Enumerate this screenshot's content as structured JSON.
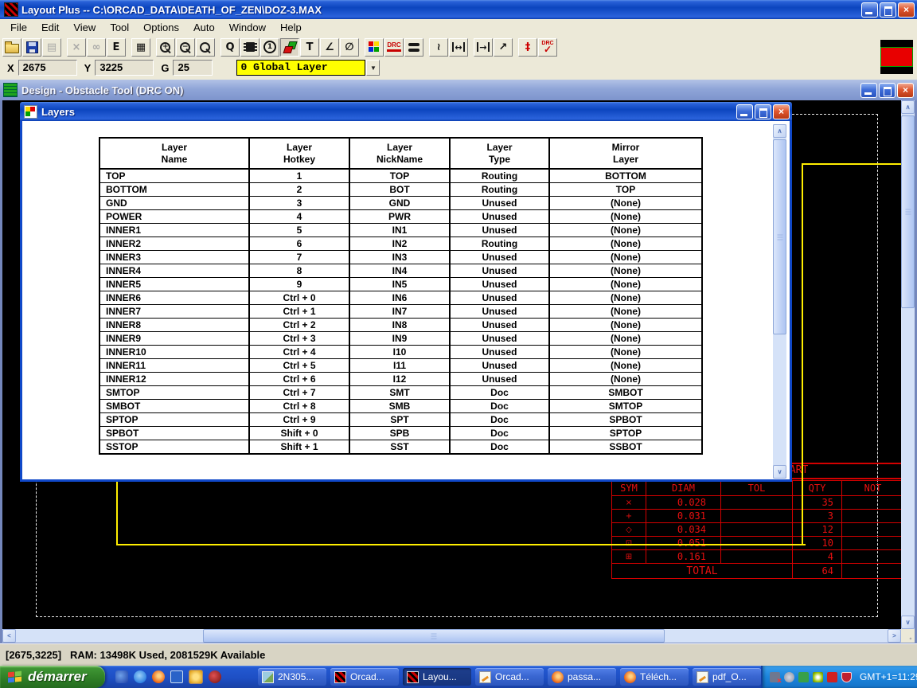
{
  "window": {
    "title": "Layout Plus -- C:\\ORCAD_DATA\\DEATH_OF_ZEN\\DOZ-3.MAX"
  },
  "menu": {
    "items": [
      "File",
      "Edit",
      "View",
      "Tool",
      "Options",
      "Auto",
      "Window",
      "Help"
    ]
  },
  "toolbar": {
    "buttons": [
      {
        "name": "open-button",
        "icon": "open-folder-icon",
        "kind": "folder"
      },
      {
        "name": "save-button",
        "icon": "save-floppy-icon",
        "kind": "floppy"
      },
      {
        "name": "library-button",
        "icon": "library-icon",
        "kind": "glyph",
        "glyph": "▤",
        "disabled": true
      },
      {
        "name": "delete-button",
        "icon": "delete-icon",
        "kind": "glyph",
        "glyph": "×",
        "disabled": true,
        "gap": true
      },
      {
        "name": "find-button",
        "icon": "find-binoculars-icon",
        "kind": "glyph",
        "glyph": "∞",
        "disabled": true
      },
      {
        "name": "edit-button",
        "icon": "edit-icon",
        "kind": "glyph",
        "glyph": "E"
      },
      {
        "name": "spreadsheet-button",
        "icon": "spreadsheet-icon",
        "kind": "glyph",
        "glyph": "▦",
        "gap": true
      },
      {
        "name": "zoom-in-button",
        "icon": "zoom-in-icon",
        "kind": "mag",
        "glyph": "+",
        "gap": true
      },
      {
        "name": "zoom-out-button",
        "icon": "zoom-out-icon",
        "kind": "mag",
        "glyph": "−"
      },
      {
        "name": "zoom-all-button",
        "icon": "zoom-all-icon",
        "kind": "mag",
        "glyph": ""
      },
      {
        "name": "query-button",
        "icon": "query-icon",
        "kind": "glyph",
        "glyph": "Q",
        "gap": true
      },
      {
        "name": "component-button",
        "icon": "component-chip-icon",
        "kind": "chip"
      },
      {
        "name": "pin-button",
        "icon": "pin-number-icon",
        "kind": "circlenum",
        "glyph": "1"
      },
      {
        "name": "obstacle-button",
        "icon": "obstacle-icon",
        "kind": "obstacle",
        "pressed": true
      },
      {
        "name": "text-button",
        "icon": "text-icon",
        "kind": "glyph",
        "glyph": "T"
      },
      {
        "name": "dimension-button",
        "icon": "dimension-icon",
        "kind": "glyph",
        "glyph": "∠"
      },
      {
        "name": "no-connect-button",
        "icon": "no-connect-icon",
        "kind": "glyph",
        "glyph": "∅"
      },
      {
        "name": "colors-button",
        "icon": "colors-palette-icon",
        "kind": "colors",
        "gap": true
      },
      {
        "name": "drc-box-button",
        "icon": "drc-box-icon",
        "kind": "drc",
        "glyph": "DRC"
      },
      {
        "name": "reconnect-button",
        "icon": "ratsnest-icon",
        "kind": "pills"
      },
      {
        "name": "route-button",
        "icon": "route-icon",
        "kind": "glyph",
        "glyph": "≀",
        "gap": true
      },
      {
        "name": "shove-track-button",
        "icon": "shove-track-icon",
        "kind": "glyph2",
        "glyph": "↔"
      },
      {
        "name": "edit-segment-button",
        "icon": "edit-segment-icon",
        "kind": "glyph2",
        "glyph": "→",
        "gap": true
      },
      {
        "name": "auto-path-button",
        "icon": "auto-path-icon",
        "kind": "glyph",
        "glyph": "↗"
      },
      {
        "name": "error-marker-button",
        "icon": "error-marker-icon",
        "kind": "glyph",
        "glyph": "‡",
        "color": "#CC0000",
        "gap": true
      },
      {
        "name": "drc-check-button",
        "icon": "drc-check-icon",
        "kind": "drccheck",
        "glyph": "DRC"
      }
    ]
  },
  "coordinates": {
    "x_label": "X",
    "x_value": "2675",
    "y_label": "Y",
    "y_value": "3225",
    "g_label": "G",
    "g_value": "25",
    "layer_select_value": "0 Global Layer"
  },
  "design_window": {
    "title": "Design - Obstacle Tool (DRC ON)"
  },
  "layers_dialog": {
    "title": "Layers",
    "table": {
      "headers": [
        [
          "Layer",
          "Name"
        ],
        [
          "Layer",
          "Hotkey"
        ],
        [
          "Layer",
          "NickName"
        ],
        [
          "Layer",
          "Type"
        ],
        [
          "Mirror",
          "Layer"
        ]
      ],
      "rows": [
        [
          "TOP",
          "1",
          "TOP",
          "Routing",
          "BOTTOM"
        ],
        [
          "BOTTOM",
          "2",
          "BOT",
          "Routing",
          "TOP"
        ],
        [
          "GND",
          "3",
          "GND",
          "Unused",
          "(None)"
        ],
        [
          "POWER",
          "4",
          "PWR",
          "Unused",
          "(None)"
        ],
        [
          "INNER1",
          "5",
          "IN1",
          "Unused",
          "(None)"
        ],
        [
          "INNER2",
          "6",
          "IN2",
          "Routing",
          "(None)"
        ],
        [
          "INNER3",
          "7",
          "IN3",
          "Unused",
          "(None)"
        ],
        [
          "INNER4",
          "8",
          "IN4",
          "Unused",
          "(None)"
        ],
        [
          "INNER5",
          "9",
          "IN5",
          "Unused",
          "(None)"
        ],
        [
          "INNER6",
          "Ctrl + 0",
          "IN6",
          "Unused",
          "(None)"
        ],
        [
          "INNER7",
          "Ctrl + 1",
          "IN7",
          "Unused",
          "(None)"
        ],
        [
          "INNER8",
          "Ctrl + 2",
          "IN8",
          "Unused",
          "(None)"
        ],
        [
          "INNER9",
          "Ctrl + 3",
          "IN9",
          "Unused",
          "(None)"
        ],
        [
          "INNER10",
          "Ctrl + 4",
          "I10",
          "Unused",
          "(None)"
        ],
        [
          "INNER11",
          "Ctrl + 5",
          "I11",
          "Unused",
          "(None)"
        ],
        [
          "INNER12",
          "Ctrl + 6",
          "I12",
          "Unused",
          "(None)"
        ],
        [
          "SMTOP",
          "Ctrl + 7",
          "SMT",
          "Doc",
          "SMBOT"
        ],
        [
          "SMBOT",
          "Ctrl + 8",
          "SMB",
          "Doc",
          "SMTOP"
        ],
        [
          "SPTOP",
          "Ctrl + 9",
          "SPT",
          "Doc",
          "SPBOT"
        ],
        [
          "SPBOT",
          "Shift + 0",
          "SPB",
          "Doc",
          "SPTOP"
        ],
        [
          "SSTOP",
          "Shift + 1",
          "SST",
          "Doc",
          "SSBOT"
        ]
      ]
    }
  },
  "drill_chart": {
    "title_visible": "HART",
    "headers": [
      "SYM",
      "DIAM",
      "TOL",
      "QTY",
      "NOT"
    ],
    "rows": [
      [
        "×",
        "0.028",
        "",
        "35",
        ""
      ],
      [
        "+",
        "0.031",
        "",
        "3",
        ""
      ],
      [
        "◇",
        "0.034",
        "",
        "12",
        ""
      ],
      [
        "⊡",
        "0.051",
        "",
        "10",
        ""
      ],
      [
        "⊞",
        "0.161",
        "",
        "4",
        ""
      ]
    ],
    "total_label": "TOTAL",
    "total_qty": "64"
  },
  "status_bar": {
    "text": "[2675,3225]   RAM: 13498K Used, 2081529K Available"
  },
  "taskbar": {
    "start_label": "démarrer",
    "quick_launch": [
      "messenger-icon",
      "ie-icon",
      "firefox-quick-icon",
      "dvd-icon",
      "clock-icon",
      "media-player-icon"
    ],
    "tasks": [
      {
        "label": "2N305...",
        "icon": "image-thumbnail-icon",
        "kind": "img"
      },
      {
        "label": "Orcad...",
        "icon": "orcad-layout-icon",
        "kind": "orcad"
      },
      {
        "label": "Layou...",
        "icon": "orcad-layout-icon",
        "kind": "orcad",
        "active": true
      },
      {
        "label": "Orcad...",
        "icon": "document-pencil-icon",
        "kind": "doc"
      },
      {
        "label": "passa...",
        "icon": "firefox-icon",
        "kind": "ff"
      },
      {
        "label": "Téléch...",
        "icon": "firefox-icon",
        "kind": "ff"
      },
      {
        "label": "pdf_O...",
        "icon": "document-pencil-icon",
        "kind": "doc"
      }
    ],
    "tray_icons": [
      "network-disabled-icon",
      "volume-icon",
      "network-icon",
      "wireless-signal-icon",
      "antivirus-icon",
      "security-shield-icon"
    ],
    "clock": "GMT+1=11:29"
  },
  "colors": {
    "titlebar_blue": "#0C45BE",
    "close_red": "#E0562E",
    "toolbar_gray": "#ECE9D8",
    "layer_select_yellow": "#FFFF00",
    "board_outline_yellow": "#FFEE00",
    "drill_chart_red": "#D40000",
    "swatch_red": "#E80000",
    "taskbar_blue": "#1E4FC4",
    "start_green": "#2E7D26"
  }
}
